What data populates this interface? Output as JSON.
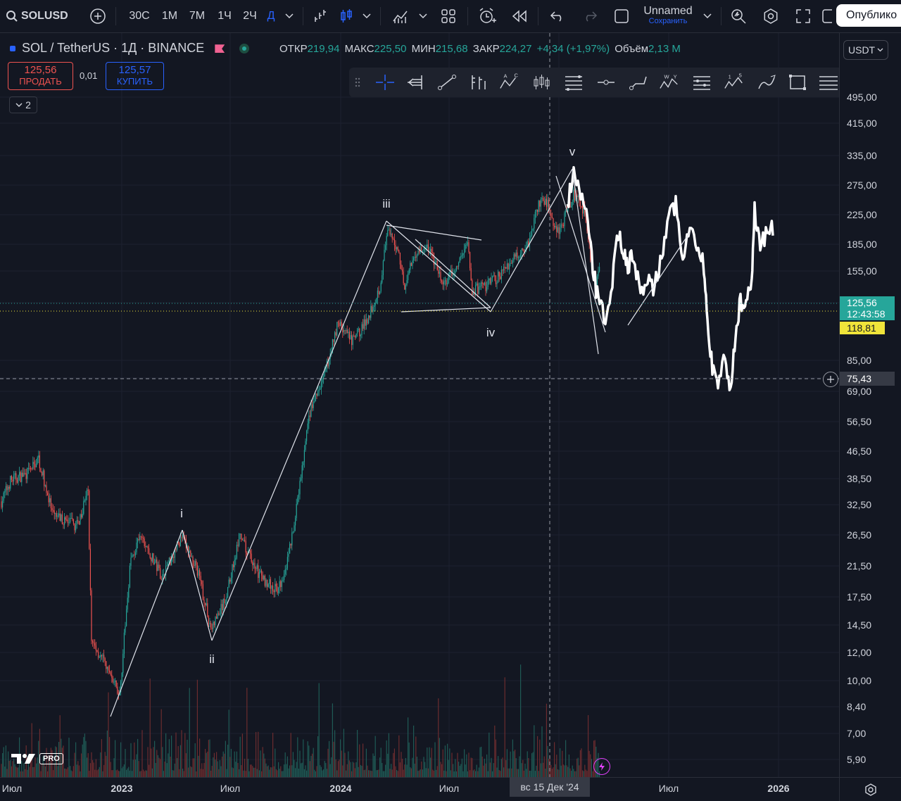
{
  "toolbar": {
    "symbol": "SOLUSD",
    "intervals": [
      "30С",
      "1М",
      "7М",
      "1Ч",
      "2Ч",
      "Д"
    ],
    "layout_name": "Unnamed",
    "layout_save": "Сохранить",
    "publish": "Опублико"
  },
  "legend": {
    "title": "SOL / TetherUS · 1Д · BINANCE",
    "open_label": "ОТКР",
    "open": "219,94",
    "high_label": "МАКС",
    "high": "225,50",
    "low_label": "МИН",
    "low": "215,68",
    "close_label": "ЗАКР",
    "close": "224,27",
    "change": "+4,34 (+1,97%)",
    "volume_label": "Объём",
    "volume": "2,13 M",
    "sell_price": "125,56",
    "sell_label": "ПРОДАТЬ",
    "spread": "0,01",
    "buy_price": "125,57",
    "buy_label": "КУПИТЬ",
    "collapse_count": "2"
  },
  "currency": "USDT",
  "price_axis": [
    "495,00",
    "415,00",
    "335,00",
    "275,00",
    "225,00",
    "185,00",
    "155,00",
    "125,56",
    "85,00",
    "75,43",
    "69,00",
    "56,50",
    "46,50",
    "38,50",
    "32,50",
    "26,50",
    "21,50",
    "17,50",
    "14,50",
    "12,00",
    "10,00",
    "8,40",
    "7,00",
    "5,90"
  ],
  "current_price": "125,56",
  "countdown": "12:43:58",
  "line_price": "118,81",
  "crosshair_price": "75,43",
  "time_axis": [
    "Июл",
    "2023",
    "Июл",
    "2024",
    "Июл",
    "Июл",
    "2026"
  ],
  "crosshair_time": "вс 15 Дек '24",
  "wave_labels": [
    "i",
    "ii",
    "iii",
    "iv",
    "v"
  ],
  "logo": "PRO",
  "colors": {
    "up": "#26a69a",
    "down": "#ef5350",
    "accent": "#2962ff",
    "bg": "#131722",
    "price_line": "#f0e43a"
  }
}
